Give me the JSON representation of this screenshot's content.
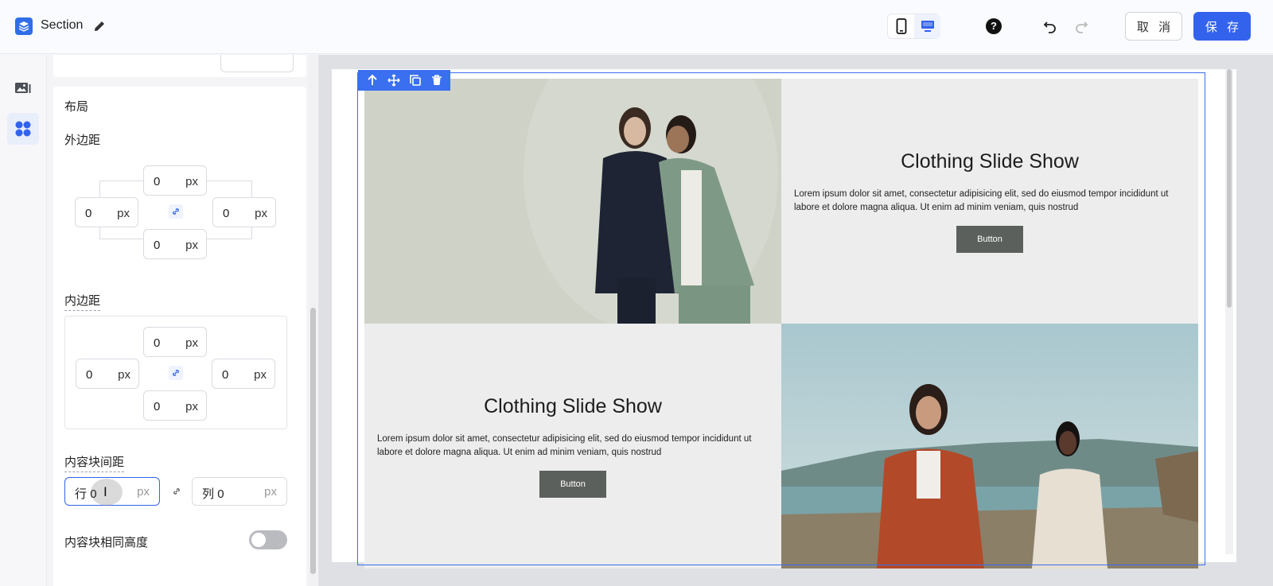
{
  "app": {
    "title": "Section"
  },
  "toolbar": {
    "devices": [
      "mobile",
      "desktop"
    ],
    "active_device": "desktop",
    "help_label": "?",
    "cancel_label": "取 消",
    "save_label": "保 存"
  },
  "colors": {
    "accent": "#3363ec",
    "selection": "#3a6ff0",
    "button_dark": "#5c605c"
  },
  "rail": {
    "items": [
      "image-gallery-icon",
      "components-icon"
    ],
    "active": "components-icon"
  },
  "panel": {
    "layout_title": "布局",
    "margin": {
      "label": "外边距",
      "top": "0",
      "left": "0",
      "right": "0",
      "bottom": "0",
      "unit": "px"
    },
    "padding": {
      "label": "内边距",
      "top": "0",
      "left": "0",
      "right": "0",
      "bottom": "0",
      "unit": "px"
    },
    "gap": {
      "label": "内容块间距",
      "row_prefix": "行",
      "row_value": "0",
      "col_prefix": "列",
      "col_value": "0",
      "unit": "px"
    },
    "equal_height": {
      "label": "内容块相同高度",
      "enabled": false
    }
  },
  "canvas": {
    "slides": [
      {
        "title": "Clothing Slide Show",
        "body": "Lorem ipsum dolor sit amet, consectetur adipisicing elit, sed do eiusmod tempor incididunt ut labore et dolore magna aliqua. Ut enim ad minim veniam, quis nostrud",
        "button": "Button"
      },
      {
        "title": "Clothing Slide Show",
        "body": "Lorem ipsum dolor sit amet, consectetur adipisicing elit, sed do eiusmod tempor incididunt ut labore et dolore magna aliqua. Ut enim ad minim veniam, quis nostrud",
        "button": "Button"
      }
    ]
  }
}
